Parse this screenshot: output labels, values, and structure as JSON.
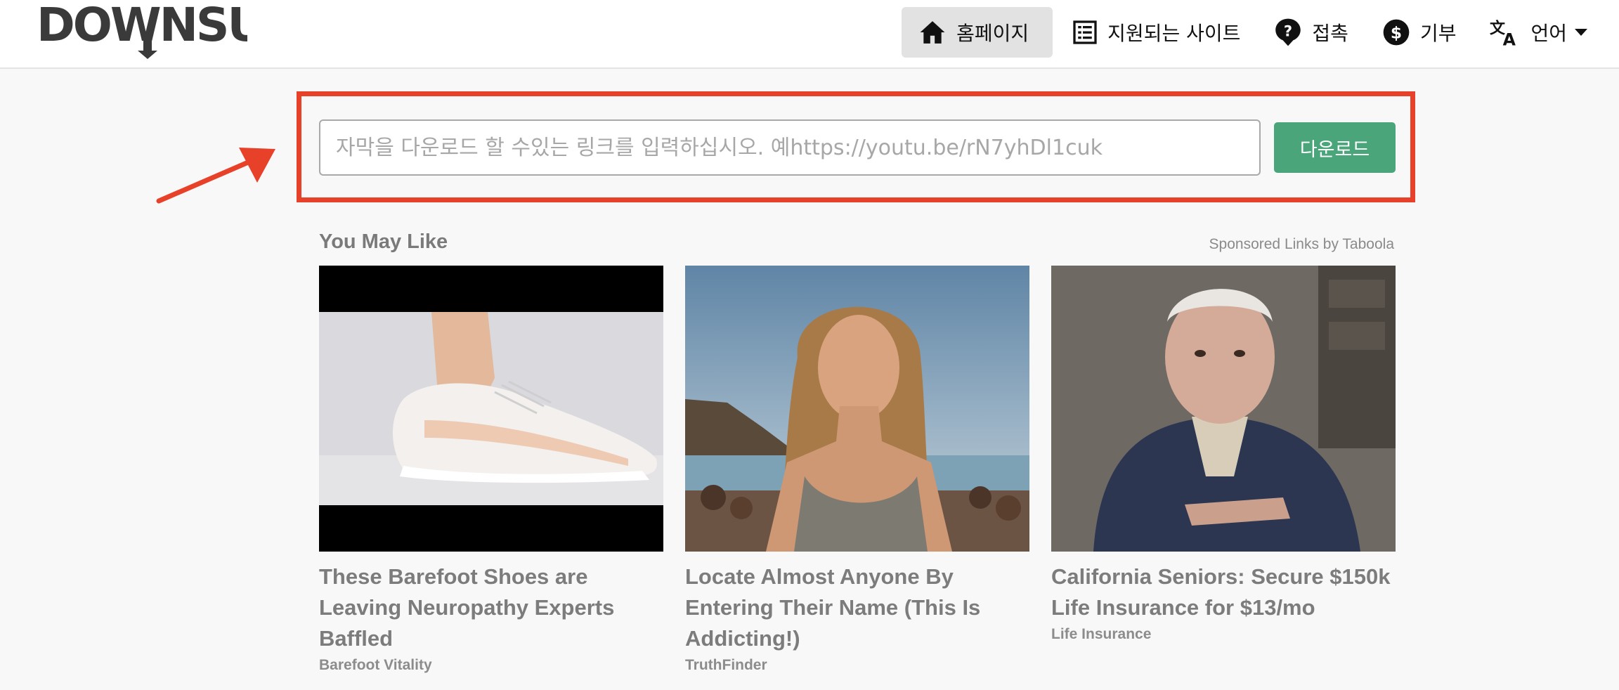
{
  "header": {
    "logo_text": "DOWNSUB",
    "nav": [
      {
        "label": "홈페이지",
        "icon": "home-icon"
      },
      {
        "label": "지원되는 사이트",
        "icon": "list-icon"
      },
      {
        "label": "접촉",
        "icon": "question-icon"
      },
      {
        "label": "기부",
        "icon": "dollar-icon"
      },
      {
        "label": "언어",
        "icon": "translate-icon"
      }
    ]
  },
  "search": {
    "placeholder": "자막을 다운로드 할 수있는 링크를 입력하십시오. 예https://youtu.be/rN7yhDl1cuk",
    "value": "",
    "button_label": "다운로드"
  },
  "recommendations": {
    "title": "You May Like",
    "sponsored": "Sponsored Links by Taboola",
    "cards": [
      {
        "headline": "These Barefoot Shoes are Leaving Neuropathy Experts Baffled",
        "brand": "Barefoot Vitality"
      },
      {
        "headline": "Locate Almost Anyone By Entering Their Name (This Is Addicting!)",
        "brand": "TruthFinder"
      },
      {
        "headline": "California Seniors: Secure $150k Life Insurance for $13/mo",
        "brand": "Life Insurance"
      }
    ]
  },
  "colors": {
    "highlight": "#e8412a",
    "button": "#4aa57b"
  }
}
